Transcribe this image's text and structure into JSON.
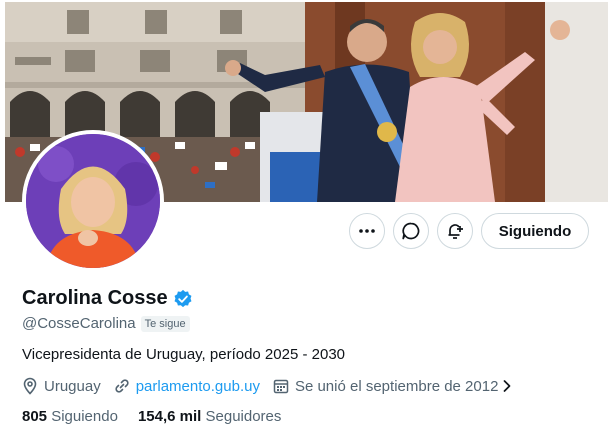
{
  "profile": {
    "name": "Carolina Cosse",
    "handle": "@CosseCarolina",
    "follows_you": "Te sigue",
    "bio": "Vicepresidenta de Uruguay, período 2025 - 2030",
    "location": "Uruguay",
    "website": "parlamento.gub.uy",
    "joined": "Se unió el septiembre de 2012"
  },
  "actions": {
    "more_icon": "more-icon",
    "message_icon": "message-icon",
    "notify_icon": "bell-plus-icon",
    "follow_label": "Siguiendo"
  },
  "stats": {
    "following_count": "805",
    "following_label": "Siguiendo",
    "followers_count": "154,6 mil",
    "followers_label": "Seguidores"
  },
  "colors": {
    "link": "#1d9bf0",
    "verified": "#1d9bf0",
    "secondary_text": "#536471",
    "border": "#cfd9de"
  }
}
